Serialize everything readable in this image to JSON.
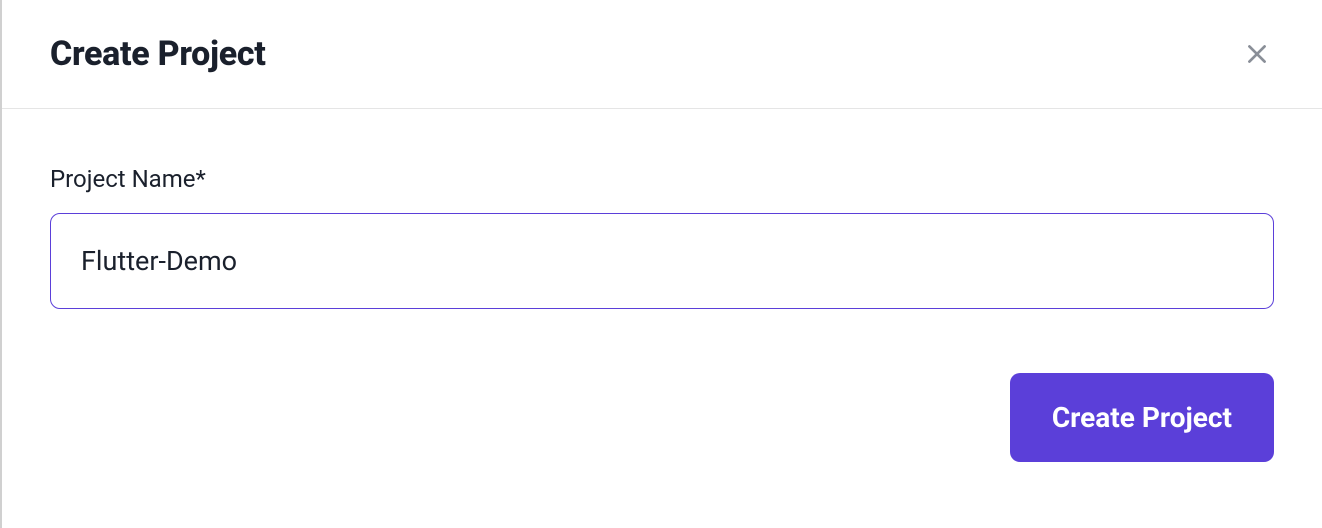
{
  "modal": {
    "title": "Create Project",
    "close_label": "Close"
  },
  "form": {
    "project_name_label": "Project Name*",
    "project_name_value": "Flutter-Demo",
    "project_name_placeholder": ""
  },
  "actions": {
    "create_button_label": "Create Project"
  },
  "colors": {
    "accent": "#5b3fd9",
    "text_primary": "#1a202c",
    "border": "#e5e5e5"
  }
}
